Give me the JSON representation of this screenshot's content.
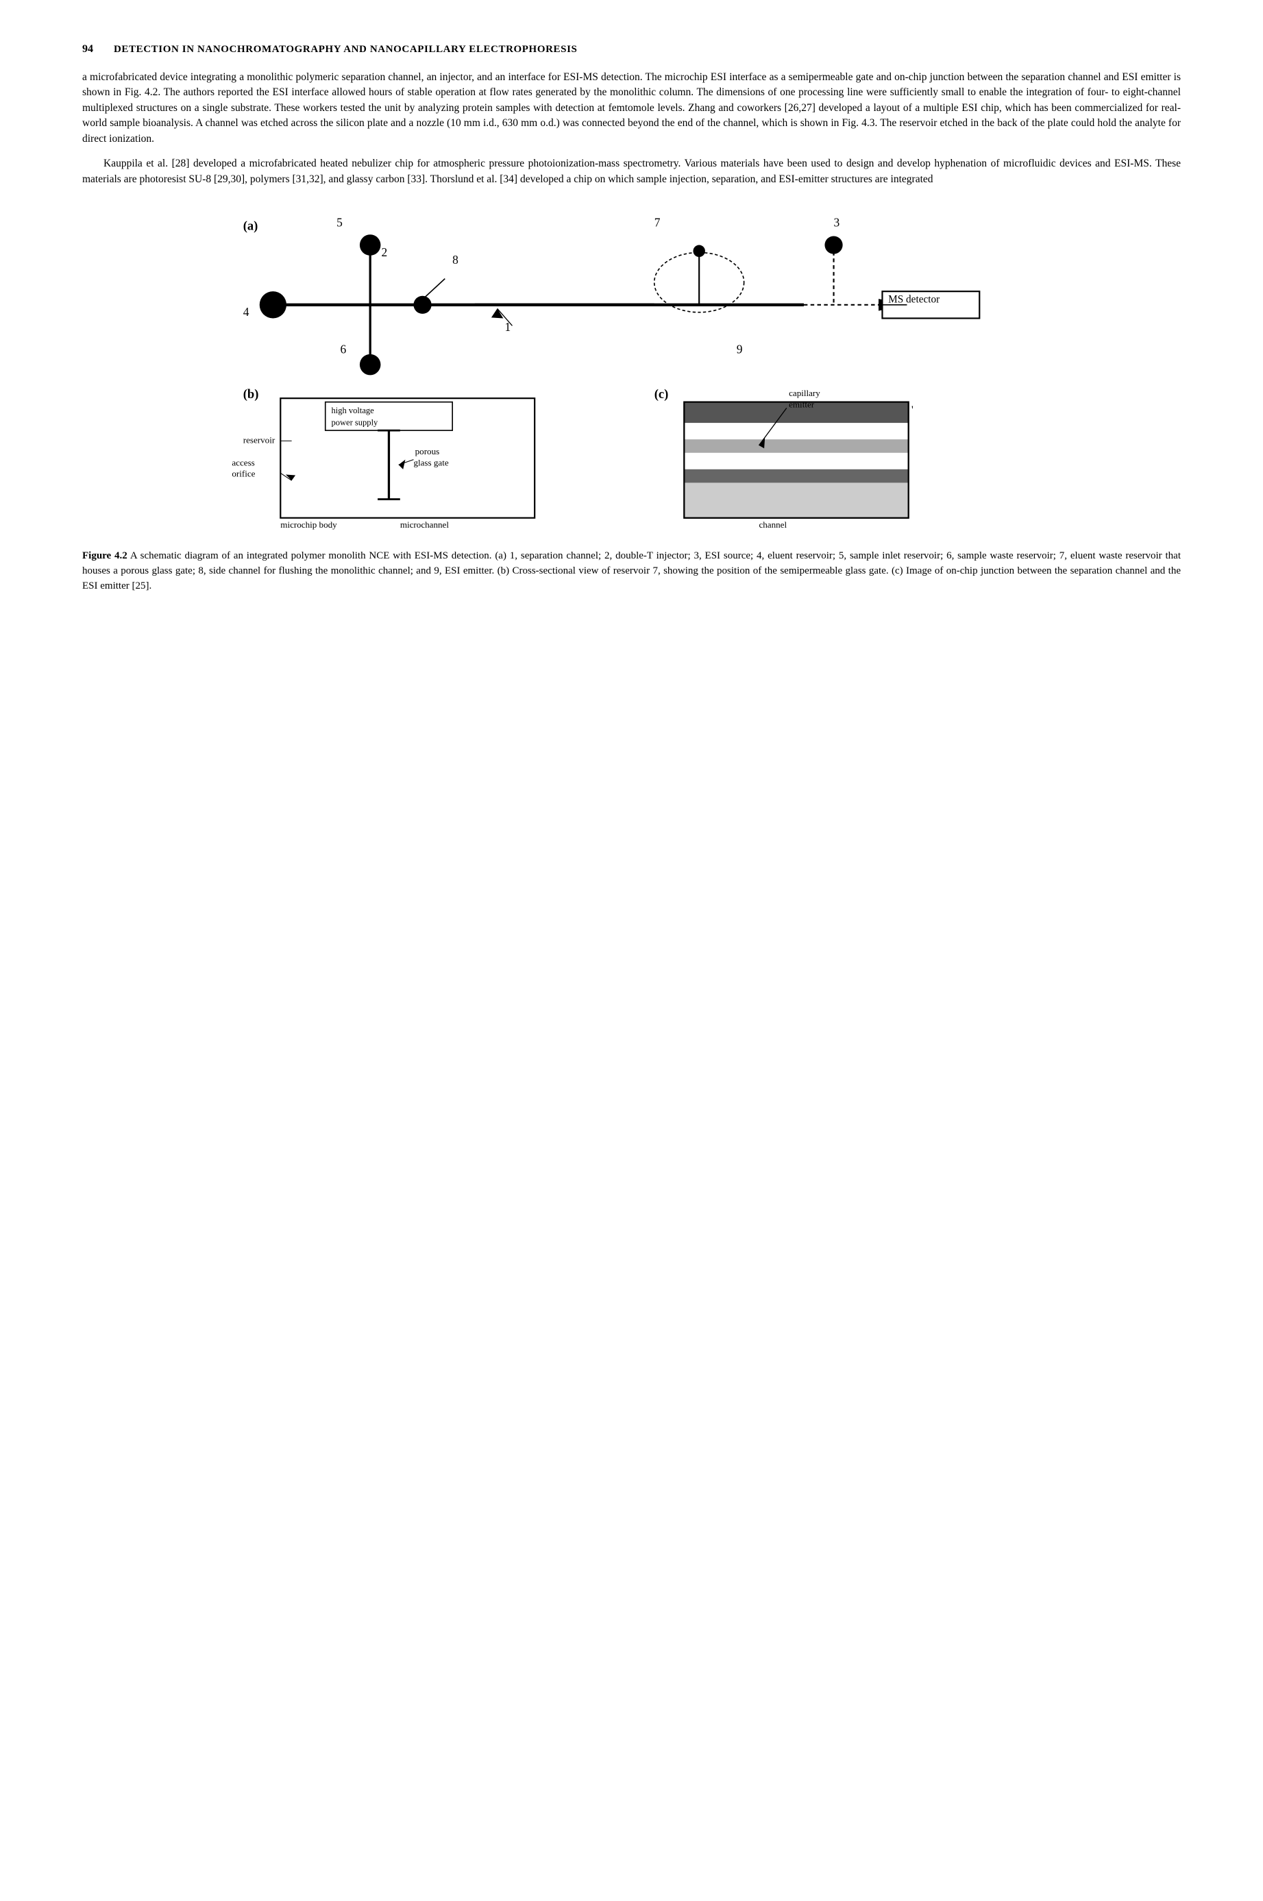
{
  "header": {
    "page_number": "94",
    "title": "DETECTION IN NANOCHROMATOGRAPHY AND NANOCAPILLARY ELECTROPHORESIS"
  },
  "paragraphs": [
    {
      "id": "p1",
      "indent": false,
      "text": "a microfabricated device integrating a monolithic polymeric separation channel, an injector, and an interface for ESI-MS detection. The microchip ESI interface as a semipermeable gate and on-chip junction between the separation channel and ESI emitter is shown in Fig. 4.2. The authors reported the ESI interface allowed hours of stable operation at flow rates generated by the monolithic column. The dimensions of one processing line were sufficiently small to enable the integration of four- to eight-channel multiplexed structures on a single substrate. These workers tested the unit by analyzing protein samples with detection at femtomole levels. Zhang and coworkers [26,27] developed a layout of a multiple ESI chip, which has been commercialized for real-world sample bioanalysis. A channel was etched across the silicon plate and a nozzle (10 mm i.d., 630 mm o.d.) was connected beyond the end of the channel, which is shown in Fig. 4.3. The reservoir etched in the back of the plate could hold the analyte for direct ionization."
    },
    {
      "id": "p2",
      "indent": true,
      "text": "Kauppila et al. [28] developed a microfabricated heated nebulizer chip for atmospheric pressure photoionization-mass spectrometry. Various materials have been used to design and develop hyphenation of microfluidic devices and ESI-MS. These materials are photoresist SU-8 [29,30], polymers [31,32], and glassy carbon [33]. Thorslund et al. [34] developed a chip on which sample injection, separation, and ESI-emitter structures are integrated"
    }
  ],
  "figure": {
    "label": "Figure 4.2",
    "caption": "A schematic diagram of an integrated polymer monolith NCE with ESI-MS detection. (a) 1, separation channel; 2, double-T injector; 3, ESI source; 4, eluent reservoir; 5, sample inlet reservoir; 6, sample waste reservoir; 7, eluent waste reservoir that houses a porous glass gate; 8, side channel for flushing the monolithic channel; and 9, ESI emitter. (b) Cross-sectional view of reservoir 7, showing the position of the semipermeable glass gate. (c) Image of on-chip junction between the separation channel and the ESI emitter [25]."
  }
}
